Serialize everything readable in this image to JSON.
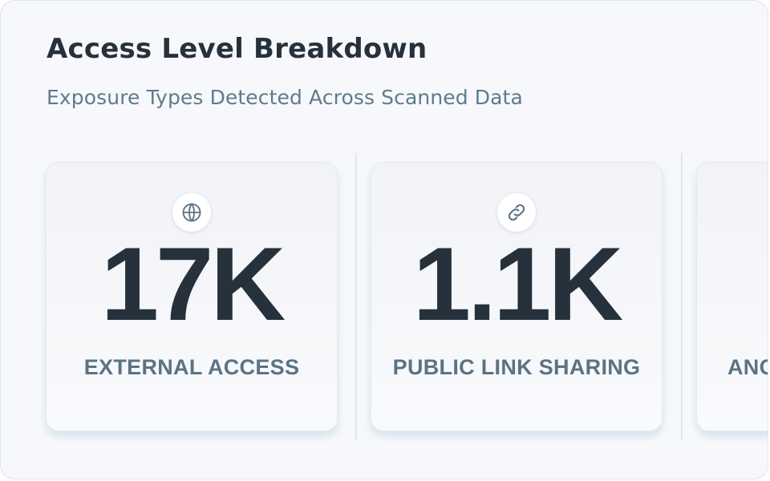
{
  "header": {
    "title": "Access Level Breakdown",
    "subtitle": "Exposure Types Detected Across Scanned Data"
  },
  "cards": [
    {
      "icon": "globe-icon",
      "value": "17K",
      "label": "EXTERNAL ACCESS"
    },
    {
      "icon": "link-icon",
      "value": "1.1K",
      "label": "PUBLIC LINK SHARING"
    },
    {
      "icon": "",
      "value": "",
      "label": "ANC"
    }
  ],
  "colors": {
    "title": "#26313b",
    "subtitle": "#5f7b8c",
    "metric_value": "#26313b",
    "metric_label": "#5b7384",
    "panel_background": "#f7f8fb",
    "card_shadow": "#9cc4d8"
  }
}
